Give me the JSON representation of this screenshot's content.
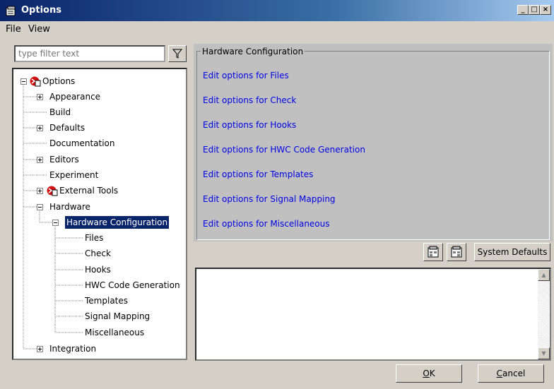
{
  "window": {
    "title": "Options"
  },
  "menu": [
    "File",
    "View"
  ],
  "filter": {
    "placeholder": "type filter text"
  },
  "tree": {
    "root": "Options",
    "items": [
      "Appearance",
      "Build",
      "Defaults",
      "Documentation",
      "Editors",
      "Experiment",
      "External Tools",
      "Hardware",
      "Hardware Configuration",
      "Files",
      "Check",
      "Hooks",
      "HWC Code Generation",
      "Templates",
      "Signal Mapping",
      "Miscellaneous",
      "Integration"
    ]
  },
  "panel": {
    "group_title": "Hardware Configuration",
    "links": [
      "Edit options for Files",
      "Edit options for Check",
      "Edit options for Hooks",
      "Edit options for HWC Code Generation",
      "Edit options for Templates",
      "Edit options for Signal Mapping",
      "Edit options for Miscellaneous"
    ]
  },
  "toolbar": {
    "system_defaults": "System Defaults"
  },
  "buttons": {
    "ok_prefix": "",
    "ok_key": "O",
    "ok_rest": "K",
    "cancel_key": "C",
    "cancel_rest": "ancel"
  },
  "colors": {
    "title_bar": "#0a246a",
    "link": "#0000e6",
    "selection": "#0a246a"
  }
}
